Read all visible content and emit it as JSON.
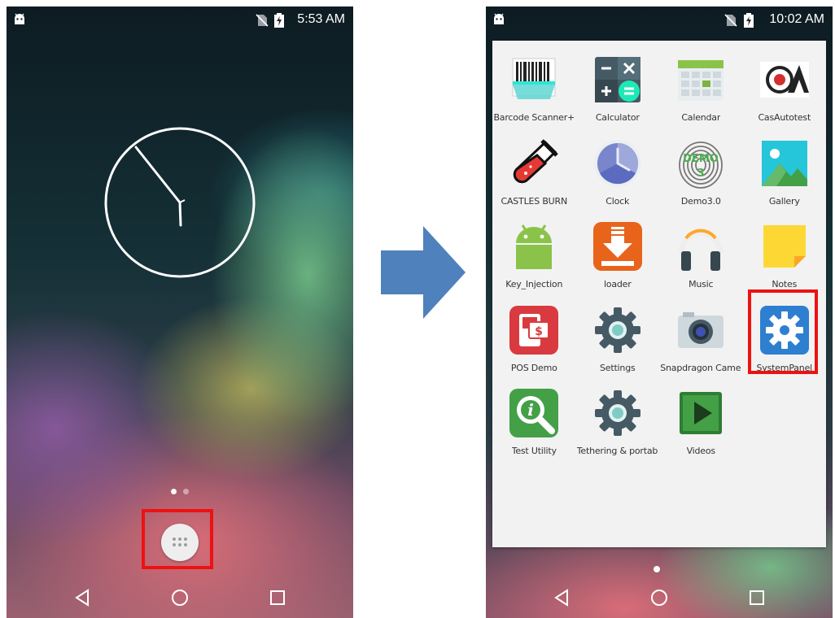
{
  "left_screen": {
    "status_time": "5:53 AM",
    "page_indicator": {
      "count": 2,
      "active": 0
    },
    "highlight_color": "#ee1111"
  },
  "right_screen": {
    "status_time": "10:02 AM",
    "apps": [
      {
        "label": "Barcode Scanner+",
        "icon": "barcode-scanner-icon"
      },
      {
        "label": "Calculator",
        "icon": "calculator-icon"
      },
      {
        "label": "Calendar",
        "icon": "calendar-icon"
      },
      {
        "label": "CasAutotest",
        "icon": "casautotest-icon"
      },
      {
        "label": "CASTLES BURN",
        "icon": "test-tube-icon"
      },
      {
        "label": "Clock",
        "icon": "clock-icon"
      },
      {
        "label": "Demo3.0",
        "icon": "fingerprint-demo-icon"
      },
      {
        "label": "Gallery",
        "icon": "gallery-icon"
      },
      {
        "label": "Key_Injection",
        "icon": "android-icon"
      },
      {
        "label": "loader",
        "icon": "download-icon"
      },
      {
        "label": "Music",
        "icon": "headphones-icon"
      },
      {
        "label": "Notes",
        "icon": "sticky-note-icon"
      },
      {
        "label": "POS Demo",
        "icon": "pos-terminal-icon"
      },
      {
        "label": "Settings",
        "icon": "settings-gear-icon"
      },
      {
        "label": "Snapdragon Came..",
        "icon": "camera-icon"
      },
      {
        "label": "SystemPanel",
        "icon": "systempanel-gear-icon"
      },
      {
        "label": "Test Utility",
        "icon": "magnifier-info-icon"
      },
      {
        "label": "Tethering & portab..",
        "icon": "tethering-gear-icon"
      },
      {
        "label": "Videos",
        "icon": "play-icon"
      }
    ]
  },
  "nav_icons": [
    "back-icon",
    "home-icon",
    "recents-icon"
  ],
  "colors": {
    "highlight": "#ee1111",
    "arrow": "#4f81bd",
    "drawer_background": "#f2f2f2"
  }
}
